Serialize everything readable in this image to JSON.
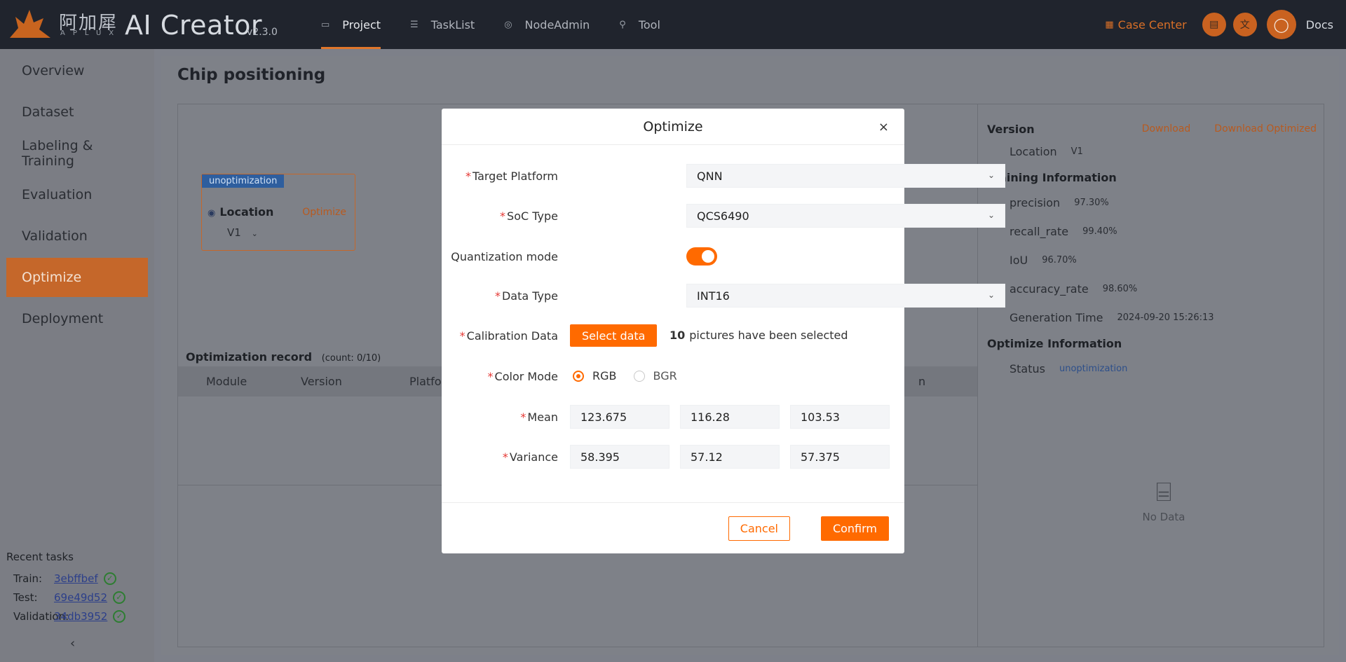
{
  "header": {
    "logo_cn": "阿加犀",
    "logo_sub": "APLUX",
    "app_name": "AI Creator",
    "version": "v2.3.0",
    "nav": [
      {
        "label": "Project",
        "icon": "folder-icon"
      },
      {
        "label": "TaskList",
        "icon": "list-icon"
      },
      {
        "label": "NodeAdmin",
        "icon": "node-icon"
      },
      {
        "label": "Tool",
        "icon": "wrench-icon"
      }
    ],
    "case_center": "Case Center",
    "docs": "Docs"
  },
  "sidebar": {
    "items": [
      "Overview",
      "Dataset",
      "Labeling & Training",
      "Evaluation",
      "Validation",
      "Optimize",
      "Deployment"
    ],
    "active": "Optimize",
    "recent_title": "Recent tasks",
    "recent": [
      {
        "label": "Train:",
        "id": "3ebffbef"
      },
      {
        "label": "Test:",
        "id": "69e49d52"
      },
      {
        "label": "Validation:",
        "id": "34db3952"
      }
    ],
    "collapse_glyph": "‹"
  },
  "main": {
    "title": "Chip positioning",
    "node": {
      "tag": "unoptimization",
      "name": "Location",
      "action": "Optimize",
      "version": "V1"
    },
    "record": {
      "title": "Optimization record",
      "count": "(count:  0/10)",
      "columns": [
        "Module",
        "Version",
        "Platfor",
        "n"
      ]
    },
    "info": {
      "version_title": "Version",
      "download": "Download",
      "download_optimized": "Download Optimized",
      "location_label": "Location",
      "location_value": "V1",
      "training_title": "Training Information",
      "metrics": [
        {
          "label": "precision",
          "value": "97.30%"
        },
        {
          "label": "recall_rate",
          "value": "99.40%"
        },
        {
          "label": "IoU",
          "value": "96.70%"
        },
        {
          "label": "accuracy_rate",
          "value": "98.60%"
        },
        {
          "label": "Generation Time",
          "value": "2024-09-20 15:26:13"
        }
      ],
      "optimize_title": "Optimize Information",
      "status_label": "Status",
      "status_value": "unoptimization",
      "no_data": "No Data"
    }
  },
  "modal": {
    "title": "Optimize",
    "close": "×",
    "target_platform_label": "Target Platform",
    "target_platform_value": "QNN",
    "soc_type_label": "SoC Type",
    "soc_type_value": "QCS6490",
    "quant_label": "Quantization mode",
    "quant_on": true,
    "data_type_label": "Data Type",
    "data_type_value": "INT16",
    "calib_label": "Calibration Data",
    "select_data": "Select data",
    "selected_count": "10",
    "selected_text": "pictures have been selected",
    "color_mode_label": "Color Mode",
    "color_options": [
      "RGB",
      "BGR"
    ],
    "color_selected": "RGB",
    "mean_label": "Mean",
    "mean_values": [
      "123.675",
      "116.28",
      "103.53"
    ],
    "variance_label": "Variance",
    "variance_values": [
      "58.395",
      "57.12",
      "57.375"
    ],
    "cancel": "Cancel",
    "confirm": "Confirm"
  },
  "colors": {
    "accent": "#ff6a00",
    "header_bg": "#20242d",
    "overlay": "#7e8188"
  }
}
